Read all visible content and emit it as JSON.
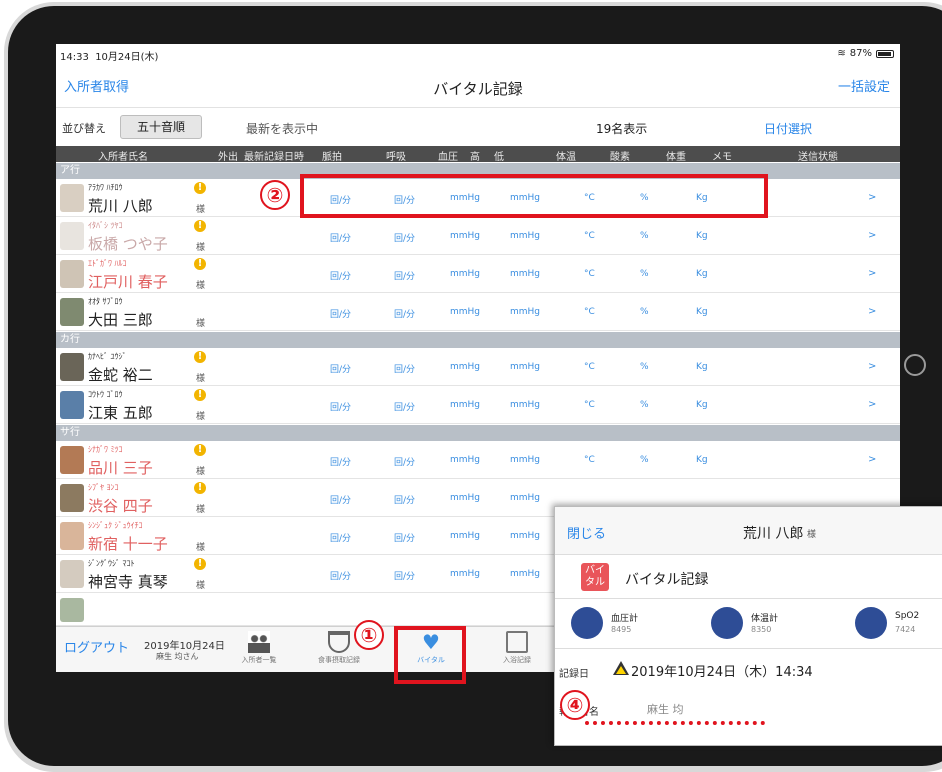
{
  "status": {
    "time": "14:33",
    "date": "10月24日(木)",
    "battery": "87%"
  },
  "nav": {
    "left": "入所者取得",
    "title": "バイタル記録",
    "right": "一括設定"
  },
  "sortbar": {
    "label": "並び替え",
    "sort_button": "五十音順",
    "latest": "最新を表示中",
    "count": "19名表示",
    "date_select": "日付選択"
  },
  "columns": [
    "入所者氏名",
    "外出",
    "最新記録日時",
    "脈拍",
    "呼吸",
    "血圧",
    "高",
    "低",
    "体温",
    "酸素",
    "体重",
    "メモ",
    "送信状態"
  ],
  "units": {
    "pulse": "回/分",
    "resp": "回/分",
    "bp_high": "mmHg",
    "bp_low": "mmHg",
    "temp": "°C",
    "oxygen": "%",
    "weight": "Kg",
    "chevron": ">"
  },
  "sections": [
    "ア行",
    "カ行",
    "サ行"
  ],
  "residents": [
    {
      "kana": "ｱﾗｶﾜ ﾊﾁﾛｳ",
      "name": "荒川 八郎",
      "suffix": "様"
    },
    {
      "kana": "ｲﾀﾊﾞｼ ﾂﾔｺ",
      "name": "板橋 つや子",
      "suffix": "様"
    },
    {
      "kana": "ｴﾄﾞｶﾞﾜ ﾊﾙｺ",
      "name": "江戸川 春子",
      "suffix": "様"
    },
    {
      "kana": "ｵｵﾀ ｻﾌﾞﾛｳ",
      "name": "大田 三郎",
      "suffix": "様"
    },
    {
      "kana": "ｶﾅﾍﾋﾞ ﾕｳｼﾞ",
      "name": "金蛇 裕二",
      "suffix": "様"
    },
    {
      "kana": "ｺｳﾄｳ ｺﾞﾛｳ",
      "name": "江東 五郎",
      "suffix": "様"
    },
    {
      "kana": "ｼﾅｶﾞﾜ ﾐﾂｺ",
      "name": "品川 三子",
      "suffix": "様"
    },
    {
      "kana": "ｼﾌﾞﾔ ﾖﾝｺ",
      "name": "渋谷 四子",
      "suffix": "様"
    },
    {
      "kana": "ｼﾝｼﾞｭｸ ｼﾞｭｳｲﾁｺ",
      "name": "新宿 十一子",
      "suffix": "様"
    },
    {
      "kana": "ｼﾞﾝｸﾞｳｼﾞ ﾏｺﾄ",
      "name": "神宮寺 真琴",
      "suffix": "様"
    }
  ],
  "tabbar": {
    "logout": "ログアウト",
    "date": "2019年10月24日",
    "staff": "麻生 均さん",
    "tabs": [
      "入所者一覧",
      "食事摂取記録",
      "バイタル",
      "入浴記録"
    ]
  },
  "annotations": {
    "n1": "①",
    "n2": "②",
    "n4": "④"
  },
  "popup": {
    "close": "閉じる",
    "resident": "荒川 八郎",
    "suffix": "様",
    "badge": "バイタル",
    "title": "バイタル記録",
    "devices": [
      {
        "name": "血圧計",
        "id": "8495"
      },
      {
        "name": "体温計",
        "id": "8350"
      },
      {
        "name": "SpO2",
        "id": "7424"
      }
    ],
    "record_label": "記録日",
    "record_date": "2019年10月24日（木）14:34",
    "reporter_label": "報告者名",
    "reporter": "麻生 均"
  },
  "colors": {
    "accent": "#2a86e8",
    "annotation": "#e0141e",
    "header": "#4d4d4d",
    "section": "#b8bfc7"
  }
}
